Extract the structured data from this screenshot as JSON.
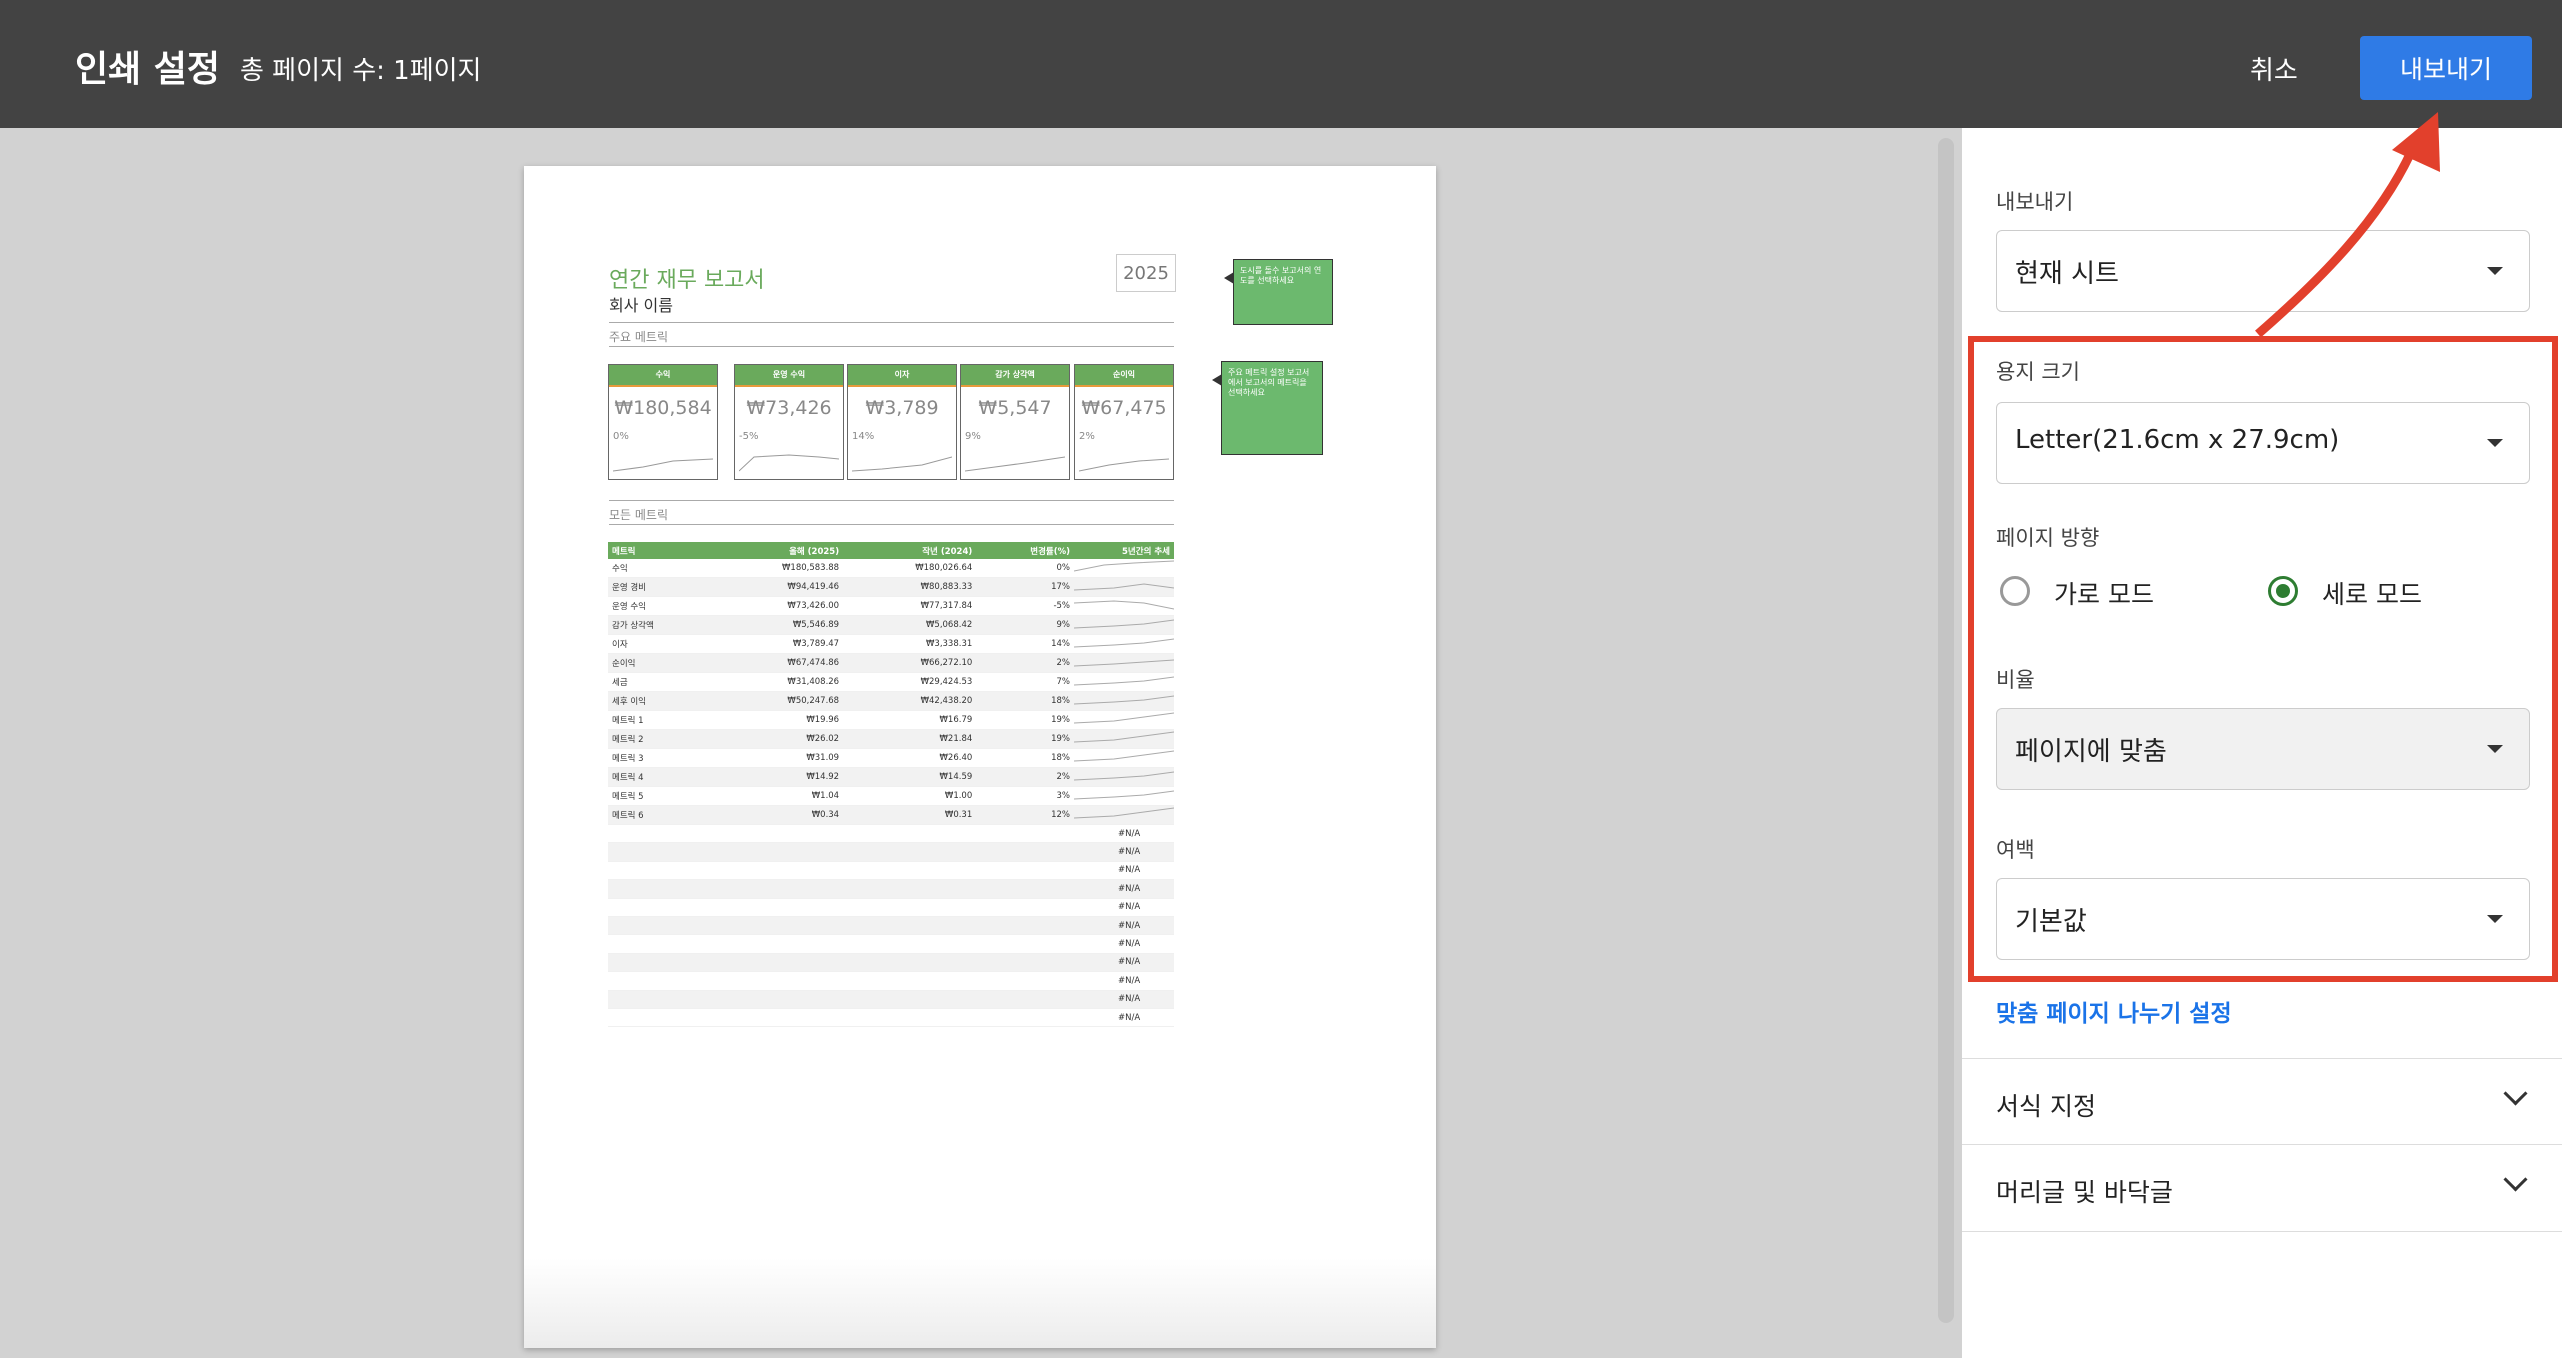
{
  "header": {
    "title": "인쇄 설정",
    "page_count": "총 페이지 수: 1페이지",
    "cancel_label": "취소",
    "export_label": "내보내기"
  },
  "sheet": {
    "title": "연간 재무 보고서",
    "company": "회사 이름",
    "year": "2025",
    "section_key": "주요 메트릭",
    "section_all": "모든 메트릭",
    "note1": "도시를 돌수 보고서의 연도를 선택하세요",
    "note2": "주요 메트릭 설정 보고서에서 보고서의 메트릭을 선택하세요",
    "cards": [
      {
        "label": "수익",
        "value": "₩180,584",
        "pct": "0%"
      },
      {
        "label": "운영 수익",
        "value": "₩73,426",
        "pct": "-5%"
      },
      {
        "label": "이자",
        "value": "₩3,789",
        "pct": "14%"
      },
      {
        "label": "감가 상각액",
        "value": "₩5,547",
        "pct": "9%"
      },
      {
        "label": "순이익",
        "value": "₩67,475",
        "pct": "2%"
      }
    ],
    "table_headers": [
      "메트릭",
      "올해 (2025)",
      "작년 (2024)",
      "변경률(%)",
      "5년간의 추세"
    ],
    "rows": [
      [
        "수익",
        "₩180,583.88",
        "₩180,026.64",
        "0%"
      ],
      [
        "운영 경비",
        "₩94,419.46",
        "₩80,883.33",
        "17%"
      ],
      [
        "운영 수익",
        "₩73,426.00",
        "₩77,317.84",
        "-5%"
      ],
      [
        "감가 상각액",
        "₩5,546.89",
        "₩5,068.42",
        "9%"
      ],
      [
        "이자",
        "₩3,789.47",
        "₩3,338.31",
        "14%"
      ],
      [
        "순이익",
        "₩67,474.86",
        "₩66,272.10",
        "2%"
      ],
      [
        "세금",
        "₩31,408.26",
        "₩29,424.53",
        "7%"
      ],
      [
        "세후 이익",
        "₩50,247.68",
        "₩42,438.20",
        "18%"
      ],
      [
        "메트릭 1",
        "₩19.96",
        "₩16.79",
        "19%"
      ],
      [
        "메트릭 2",
        "₩26.02",
        "₩21.84",
        "19%"
      ],
      [
        "메트릭 3",
        "₩31.09",
        "₩26.40",
        "18%"
      ],
      [
        "메트릭 4",
        "₩14.92",
        "₩14.59",
        "2%"
      ],
      [
        "메트릭 5",
        "₩1.04",
        "₩1.00",
        "3%"
      ],
      [
        "메트릭 6",
        "₩0.34",
        "₩0.31",
        "12%"
      ]
    ],
    "na_rows": [
      "#N/A",
      "#N/A",
      "#N/A",
      "#N/A",
      "#N/A",
      "#N/A",
      "#N/A",
      "#N/A",
      "#N/A",
      "#N/A",
      "#N/A"
    ]
  },
  "panel": {
    "export_label": "내보내기",
    "export_value": "현재 시트",
    "paper_label": "용지 크기",
    "paper_value": "Letter(21.6cm x 27.9cm)",
    "orientation_label": "페이지 방향",
    "landscape_label": "가로 모드",
    "portrait_label": "세로 모드",
    "orientation_selected": "세로 모드",
    "scale_label": "비율",
    "scale_value": "페이지에 맞춤",
    "margin_label": "여백",
    "margin_value": "기본값",
    "custom_breaks_link": "맞춤 페이지 나누기 설정",
    "formatting_label": "서식 지정",
    "header_footer_label": "머리글 및 바닥글"
  },
  "colors": {
    "topbar": "#434343",
    "export_button": "#2f7be6",
    "accent_green": "#6aaa5c",
    "highlight_red": "#e2402c",
    "radio_selected": "#2e7d32"
  }
}
